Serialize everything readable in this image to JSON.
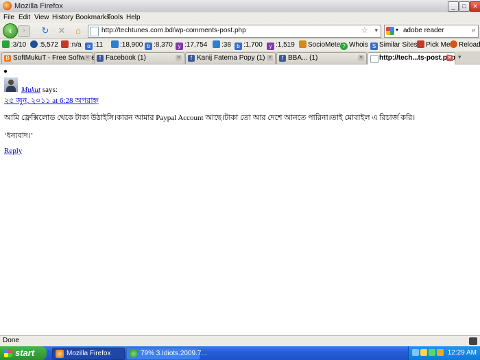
{
  "window": {
    "title": "Mozilla Firefox",
    "controls": [
      "_",
      "□",
      "✕"
    ]
  },
  "menu": [
    {
      "label": "File"
    },
    {
      "label": "Edit"
    },
    {
      "label": "View"
    },
    {
      "label": "History"
    },
    {
      "label": "Bookmarks"
    },
    {
      "label": "Tools"
    },
    {
      "label": "Help"
    }
  ],
  "nav": {
    "url": "http://techtunes.com.bd/wp-comments-post.php",
    "search_value": "adobe reader"
  },
  "toolbar": [
    {
      "text": ":3/10",
      "color": "#2aa43a",
      "icon": "pagerank-icon"
    },
    {
      "text": ":5,572",
      "color": "#1d4f9a",
      "icon": "alexa-globe-icon"
    },
    {
      "text": ":n/a",
      "color": "#c43a2a",
      "icon": "bars-icon"
    },
    {
      "text": ":11",
      "color": "#3b6fcf",
      "icon": "alpha-icon"
    },
    {
      "text": ":18,900",
      "color": "#2f7fd0",
      "icon": "google-index-icon"
    },
    {
      "text": ":8,370",
      "color": "#3a6ec7",
      "icon": "bing-icon"
    },
    {
      "text": ":17,754",
      "color": "#7f3aa6",
      "icon": "yahoo-icon"
    },
    {
      "text": ":38",
      "color": "#2f7fd0",
      "icon": "google-links-icon"
    },
    {
      "text": ":1,700",
      "color": "#3a6ec7",
      "icon": "bing-links-icon"
    },
    {
      "text": ":1,519",
      "color": "#7f3aa6",
      "icon": "yahoo-links-icon"
    },
    {
      "text": "SocioMeter▾",
      "color": "#d28a1b",
      "icon": "sociometer-icon"
    },
    {
      "text": "Whois",
      "color": "#2aa43a",
      "icon": "whois-icon"
    },
    {
      "text": "Similar Sites",
      "color": "#3a6ec7",
      "icon": "similar-sites-icon"
    },
    {
      "text": "Pick Me",
      "color": "#c43a2a",
      "icon": "pick-me-icon"
    },
    {
      "text": "Reload",
      "color": "#d05a1b",
      "icon": "reload-icon"
    }
  ],
  "tabs": [
    {
      "label": "SoftMukuT - Free Software ...",
      "icon": "blogger-icon",
      "color": "#f07b1a"
    },
    {
      "label": "Facebook (1)",
      "icon": "facebook-icon",
      "color": "#3b5998"
    },
    {
      "label": "Kanij Fatema Popy (1)",
      "icon": "facebook-icon",
      "color": "#3b5998"
    },
    {
      "label": "BBA... (1)",
      "icon": "facebook-icon",
      "color": "#3b5998"
    },
    {
      "label": "http://tech...ts-post.php",
      "icon": "page-icon",
      "color": "#8aa"
    }
  ],
  "comment": {
    "author": "Mukut",
    "says": " says:",
    "date": "২৫ জুন, ২০১১ at 6:28 অপরাহ্ন",
    "body1": "আমি ফ্রেক্সিলোড থেকে টাকা উঠাইসি।কারন আমার Paypal Account আছে।টাকা তো আর দেশে আনতে পারিনা।তাই মোবাইল এ রিচার্জ করি।",
    "body2": "‘ধন্যবাদ।’",
    "reply": "Reply"
  },
  "status": {
    "text": "Done"
  },
  "taskbar": {
    "start": "start",
    "tasks": [
      {
        "label": "Mozilla Firefox",
        "active": true
      },
      {
        "label": "79% 3.Idiots.2009.7..."
      }
    ],
    "time": "12:29 AM"
  }
}
